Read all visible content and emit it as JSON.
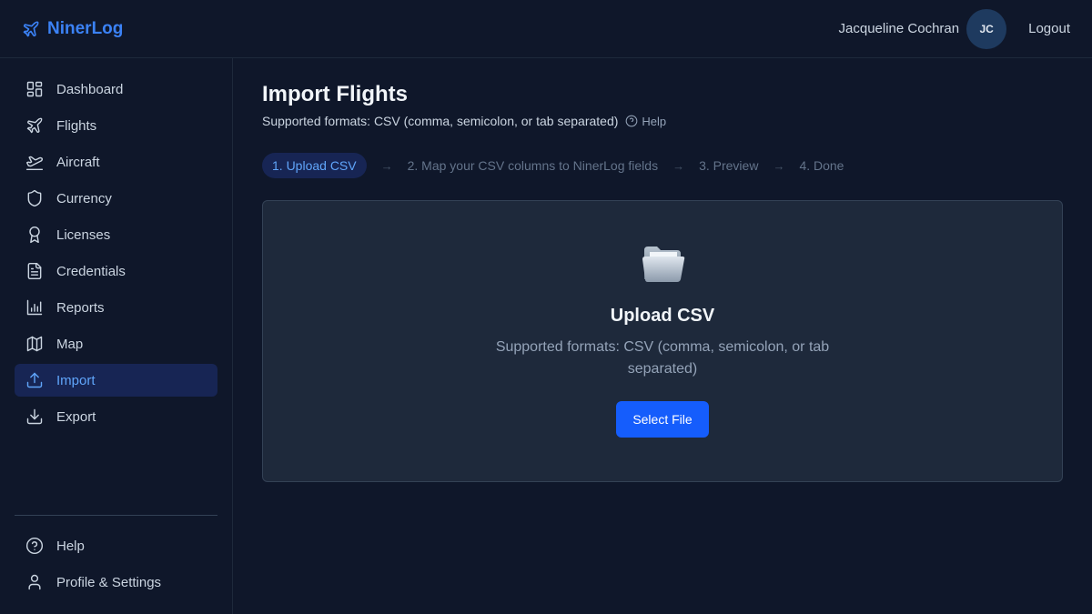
{
  "app": {
    "name": "NinerLog"
  },
  "header": {
    "user_name": "Jacqueline Cochran",
    "avatar_initials": "JC",
    "logout_label": "Logout"
  },
  "sidebar": {
    "items": [
      {
        "label": "Dashboard",
        "icon": "dashboard-icon"
      },
      {
        "label": "Flights",
        "icon": "plane-icon"
      },
      {
        "label": "Aircraft",
        "icon": "plane-takeoff-icon"
      },
      {
        "label": "Currency",
        "icon": "shield-icon"
      },
      {
        "label": "Licenses",
        "icon": "award-icon"
      },
      {
        "label": "Credentials",
        "icon": "document-icon"
      },
      {
        "label": "Reports",
        "icon": "bar-chart-icon"
      },
      {
        "label": "Map",
        "icon": "map-icon"
      },
      {
        "label": "Import",
        "icon": "upload-icon",
        "active": true
      },
      {
        "label": "Export",
        "icon": "download-icon"
      }
    ],
    "bottom_items": [
      {
        "label": "Help",
        "icon": "help-circle-icon"
      },
      {
        "label": "Profile & Settings",
        "icon": "user-icon"
      }
    ]
  },
  "page": {
    "title": "Import Flights",
    "subtitle": "Supported formats: CSV (comma, semicolon, or tab separated)",
    "help_label": "Help"
  },
  "steps": [
    {
      "label": "1. Upload CSV",
      "active": true
    },
    {
      "label": "2. Map your CSV columns to NinerLog fields"
    },
    {
      "label": "3. Preview"
    },
    {
      "label": "4. Done"
    }
  ],
  "upload": {
    "title": "Upload CSV",
    "description": "Supported formats: CSV (comma, semicolon, or tab separated)",
    "button_label": "Select File"
  },
  "colors": {
    "background": "#0f172a",
    "accent": "#3b82f6",
    "active_bg": "#172554",
    "button": "#155dfc",
    "card": "#1e293b"
  }
}
